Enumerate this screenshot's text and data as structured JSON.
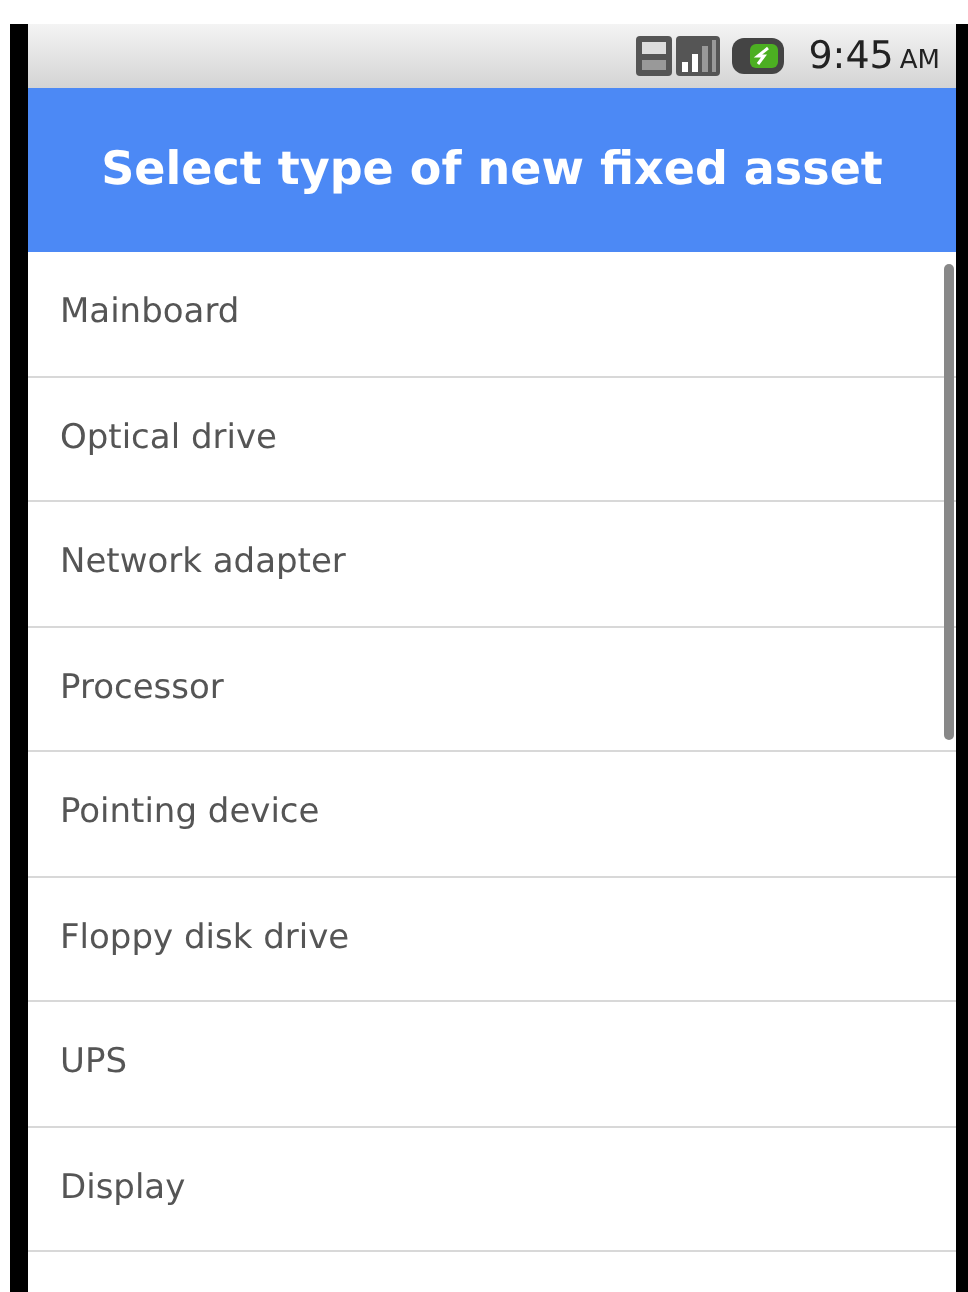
{
  "status_bar": {
    "time": "9:45",
    "period": "AM"
  },
  "title": "Select type of new fixed asset",
  "items": [
    {
      "label": "Mainboard"
    },
    {
      "label": "Optical drive"
    },
    {
      "label": "Network adapter"
    },
    {
      "label": "Processor"
    },
    {
      "label": "Pointing device"
    },
    {
      "label": "Floppy disk drive"
    },
    {
      "label": "UPS"
    },
    {
      "label": "Display"
    }
  ]
}
